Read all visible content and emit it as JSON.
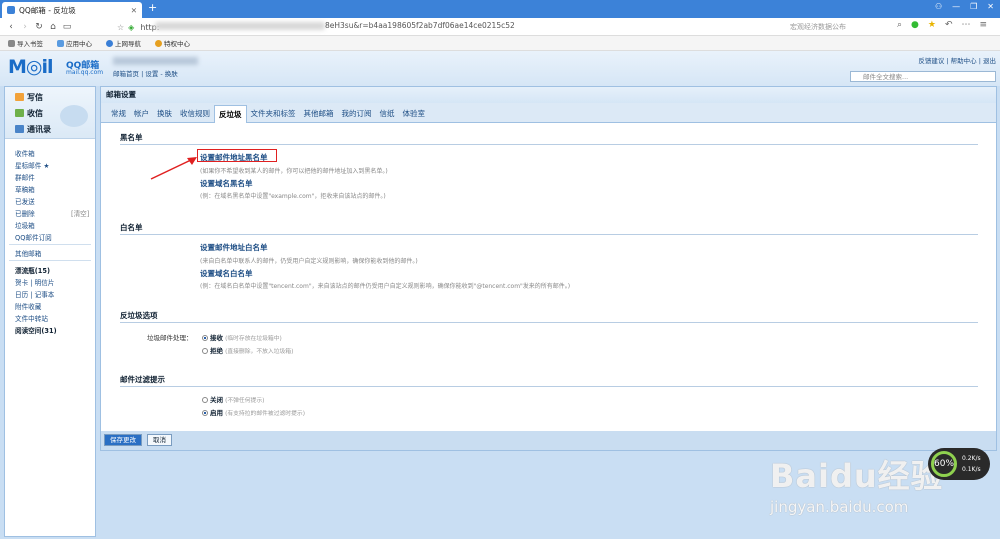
{
  "browser": {
    "tab_title": "QQ邮箱 - 反垃圾",
    "url_protocol": "http:",
    "url_rest": "8eH3su&r=b4aa198605f2ab7df06ae14ce0215c52",
    "search_placeholder": "宏观经济数据公布",
    "bookmarks": [
      "导入书签",
      "应用中心",
      "上网导航",
      "特权中心"
    ]
  },
  "mail_header": {
    "logo": "M◎il",
    "logo_cn": "QQ邮箱",
    "logo_domain": "mail.qq.com",
    "links": "邮箱首页 | 设置 - 换肤",
    "toplinks": "反馈建议 | 帮助中心 | 退出",
    "search_placeholder": "邮件全文搜索..."
  },
  "sidebar": {
    "write": "写信",
    "receive": "收信",
    "contacts": "通讯录",
    "items": [
      "收件箱",
      "星标邮件 ★",
      "群邮件",
      "草稿箱",
      "已发送",
      "已删除",
      "垃圾箱",
      "QQ邮件订阅"
    ],
    "deleted_clear": "[清空]",
    "other": "其他邮箱",
    "drift": "漂流瓶(15)",
    "cards": "贺卡 | 明信片",
    "calendar": "日历 | 记事本",
    "attach": "附件收藏",
    "transfer": "文件中转站",
    "reading": "阅读空间(31)"
  },
  "main": {
    "title": "邮箱设置",
    "tabs": [
      "常规",
      "帐户",
      "换肤",
      "收信规则",
      "反垃圾",
      "文件夹和标签",
      "其他邮箱",
      "我的订阅",
      "信纸",
      "体验室"
    ],
    "blacklist": {
      "heading": "黑名单",
      "link1": "设置邮件地址黑名单",
      "hint1": "(如果你不希望收到某人的邮件，你可以把他的邮件地址加入到黑名单。)",
      "link2": "设置域名黑名单",
      "hint2": "(例：在域名黑名单中设置\"example.com\"，拒收来自该站点的邮件。)"
    },
    "whitelist": {
      "heading": "白名单",
      "link1": "设置邮件地址白名单",
      "hint1": "(来自白名单中联系人的邮件，仍受用户自定义规则影响，确保你能收到他的邮件。)",
      "link2": "设置域名白名单",
      "hint2": "(例：在域名白名单中设置\"tencent.com\"，来自该站点的邮件仍受用户自定义规则影响，确保你能收到\"@tencent.com\"发来的所有邮件。)"
    },
    "spam": {
      "heading": "反垃圾选项",
      "label": "垃圾邮件处理：",
      "opt1": "接收",
      "opt1_hint": "(临时存放在垃圾箱中)",
      "opt2": "拒绝",
      "opt2_hint": "(直接删除，不放入垃圾箱)"
    },
    "filter": {
      "heading": "邮件过滤提示",
      "opt1": "关闭",
      "opt1_hint": "(不弹任何提示)",
      "opt2": "启用",
      "opt2_hint": "(有支持拉的邮件被过滤时提示)"
    },
    "save": "保存更改",
    "cancel": "取消"
  },
  "overlay": {
    "watermark": "Baidu经验",
    "watermark_url": "jingyan.baidu.com",
    "speed_pct": "60%",
    "speed_up": "0.2K/s",
    "speed_down": "0.1K/s"
  }
}
